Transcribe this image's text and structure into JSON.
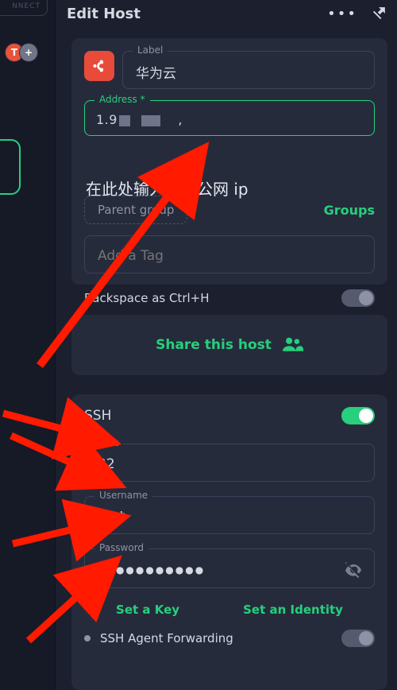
{
  "header": {
    "title": "Edit Host"
  },
  "sidebar": {
    "connect_label": "NNECT",
    "avatar_letter": "T",
    "add_symbol": "+"
  },
  "card1": {
    "label_field_label": "Label",
    "label_value": "华为云",
    "address_field_label": "Address *",
    "address_value": "1.9█ █  ,",
    "hint": "在此处输入你的公网 ip",
    "parent_group_placeholder": "Parent group",
    "groups_link": "Groups",
    "tag_placeholder": "Add a Tag",
    "backspace_label": "Backspace as Ctrl+H",
    "backspace_on": false
  },
  "share": {
    "label": "Share this host"
  },
  "ssh": {
    "title": "SSH",
    "enabled": true,
    "port_label": "Port",
    "port_value": "22",
    "username_label": "Username",
    "username_value": "root",
    "password_label": "Password",
    "password_mask": "●●●●●●●●●●●",
    "set_key": "Set a Key",
    "set_identity": "Set an Identity",
    "agent_forwarding_label": "SSH Agent Forwarding",
    "agent_forwarding_on": false
  }
}
